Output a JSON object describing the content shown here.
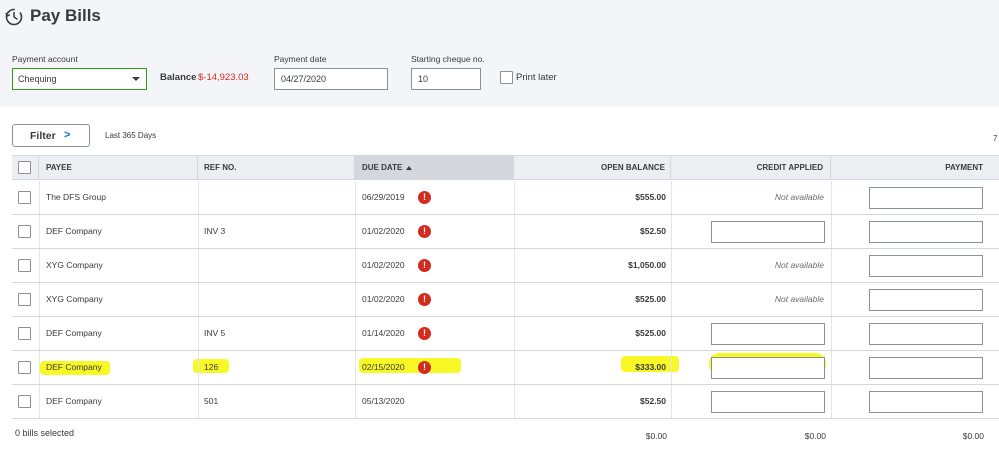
{
  "page": {
    "title": "Pay Bills",
    "title_icon": "clock-refresh-icon"
  },
  "form": {
    "payment_account_label": "Payment account",
    "payment_account_value": "Chequing",
    "balance_label": "Balance",
    "balance_value": "$-14,923.03",
    "payment_date_label": "Payment date",
    "payment_date_value": "04/27/2020",
    "starting_cheque_label": "Starting cheque no.",
    "starting_cheque_value": "10",
    "print_later_label": "Print later",
    "print_later_checked": false
  },
  "filter": {
    "label": "Filter",
    "chevron": ">",
    "note": "Last 365 Days",
    "edge_text": "7"
  },
  "table": {
    "headers": {
      "payee": "PAYEE",
      "ref_no": "REF NO.",
      "due_date": "DUE DATE",
      "open_balance": "OPEN BALANCE",
      "credit_applied": "CREDIT APPLIED",
      "payment": "PAYMENT"
    },
    "sorted_column": "DUE DATE",
    "rows": [
      {
        "payee": "The DFS Group",
        "ref_no": "",
        "due_date": "06/29/2019",
        "overdue": true,
        "open_balance": "$555.00",
        "credit": "Not available"
      },
      {
        "payee": "DEF Company",
        "ref_no": "INV 3",
        "due_date": "01/02/2020",
        "overdue": true,
        "open_balance": "$52.50",
        "credit": ""
      },
      {
        "payee": "XYG Company",
        "ref_no": "",
        "due_date": "01/02/2020",
        "overdue": true,
        "open_balance": "$1,050.00",
        "credit": "Not available"
      },
      {
        "payee": "XYG Company",
        "ref_no": "",
        "due_date": "01/02/2020",
        "overdue": true,
        "open_balance": "$525.00",
        "credit": "Not available"
      },
      {
        "payee": "DEF Company",
        "ref_no": "INV 5",
        "due_date": "01/14/2020",
        "overdue": true,
        "open_balance": "$525.00",
        "credit": ""
      },
      {
        "payee": "DEF Company",
        "ref_no": "126",
        "due_date": "02/15/2020",
        "overdue": true,
        "open_balance": "$333.00",
        "credit": "",
        "highlighted": true
      },
      {
        "payee": "DEF Company",
        "ref_no": "501",
        "due_date": "05/13/2020",
        "overdue": false,
        "open_balance": "$52.50",
        "credit": ""
      }
    ],
    "overdue_icon": "alert-icon",
    "overdue_symbol": "!"
  },
  "footer": {
    "bills_selected": "0 bills selected",
    "total_open_balance": "$0.00",
    "total_credit": "$0.00",
    "total_payment": "$0.00"
  },
  "colors": {
    "accent_green": "#2ca01c",
    "negative_red": "#d52b1e",
    "highlight_yellow": "#f7f700",
    "link_blue": "#0077c5"
  }
}
